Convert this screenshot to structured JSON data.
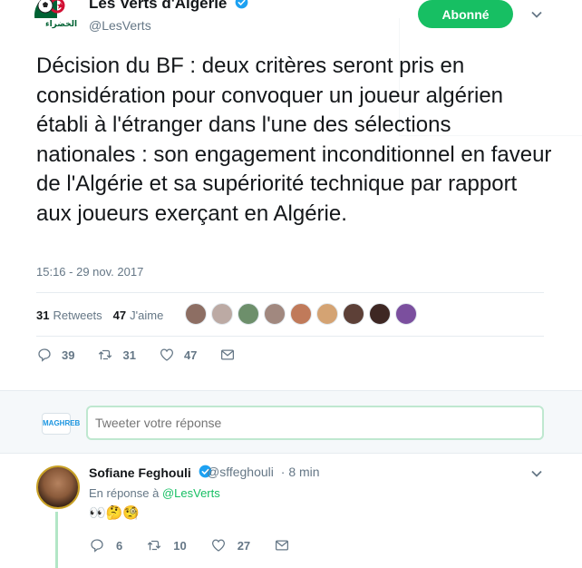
{
  "tweet": {
    "author_name": "Les Verts d'Algérie",
    "author_handle": "@LesVerts",
    "follow_label": "Abonné",
    "text": "Décision du BF : deux critères seront pris en considération pour convoquer un joueur algérien établi à l'étranger dans l'une des sélections nationales : son engagement inconditionnel en faveur de l'Algérie et sa supériorité technique par rapport aux joueurs exerçant en Algérie.",
    "timestamp": "15:16 - 29 nov. 2017",
    "retweets_count": "31",
    "retweets_label": "Retweets",
    "likes_count": "47",
    "likes_label": "J'aime",
    "reply_count": "39",
    "retweet_action_count": "31",
    "like_action_count": "47",
    "avatar_label": "الخضراء"
  },
  "reply_box": {
    "placeholder": "Tweeter votre réponse",
    "user_avatar_label": "MAGHREB"
  },
  "reply_tweet": {
    "author_name": "Sofiane Feghouli",
    "author_handle": "@sffeghouli",
    "time": "· 8 min",
    "replying_prefix": "En réponse à",
    "replying_to": "@LesVerts",
    "text": "👀🤔🧐",
    "reply_count": "6",
    "retweet_count": "10",
    "like_count": "27"
  },
  "colors": {
    "accent": "#17bf63",
    "secondary_text": "#657786",
    "verified": "#1da1f2"
  }
}
